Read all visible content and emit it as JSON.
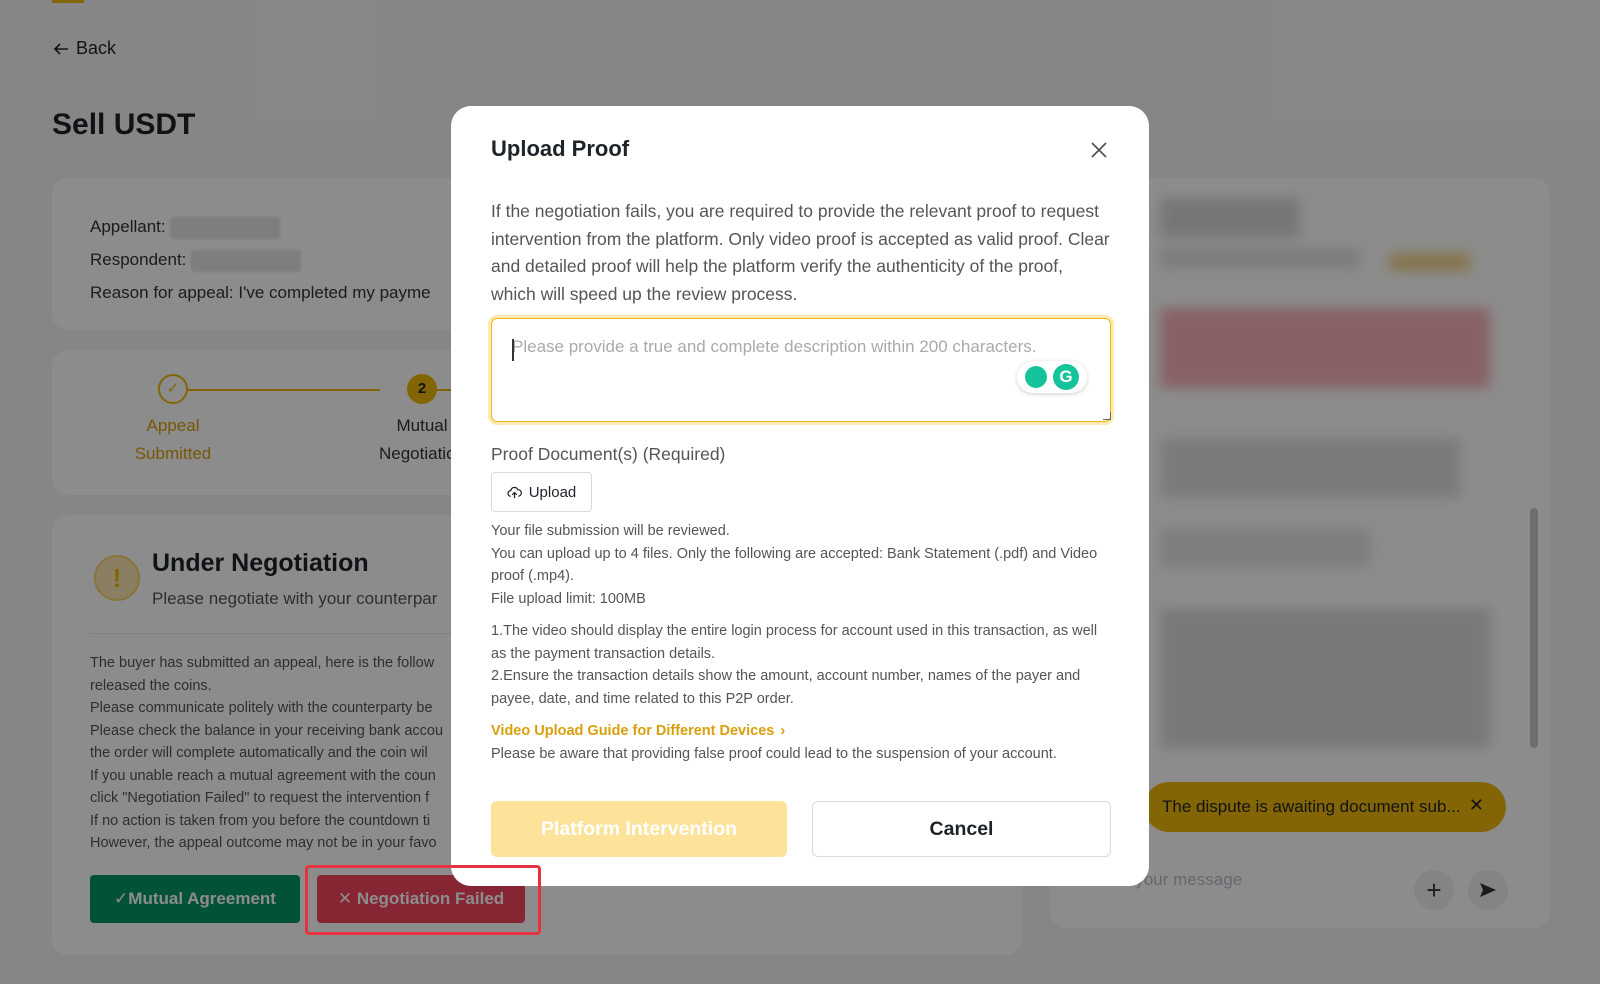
{
  "page": {
    "back_label": "Back",
    "title": "Sell USDT"
  },
  "appeal": {
    "appellant_label": "Appellant:",
    "respondent_label": "Respondent:",
    "reason_label": "Reason for appeal:",
    "reason_value": "I've completed my payme"
  },
  "steps": [
    {
      "number": "",
      "label_line1": "Appeal",
      "label_line2": "Submitted"
    },
    {
      "number": "2",
      "label_line1": "Mutual",
      "label_line2": "Negotiation"
    }
  ],
  "negotiation": {
    "title": "Under Negotiation",
    "subtitle": "Please negotiate with your counterpar",
    "body": [
      "The buyer has submitted an appeal, here is the follow",
      "released the coins.",
      "Please communicate politely with the counterparty be",
      "Please check the balance in your receiving bank accou",
      "the order will complete automatically and the coin wil",
      "If you unable reach a mutual agreement with the coun",
      "click \"Negotiation Failed\" to request the intervention f",
      "If no action is taken from you before the countdown ti",
      "However, the appeal outcome may not be in your favo"
    ],
    "agree_button": "Mutual Agreement",
    "fail_button": "Negotiation Failed"
  },
  "chat": {
    "dispute_banner": "The dispute is awaiting document sub...",
    "input_placeholder": "Enter your message"
  },
  "modal": {
    "title": "Upload Proof",
    "description": "If the negotiation fails, you are required to provide the relevant proof to request intervention from the platform. Only video proof is accepted as valid proof. Clear and detailed proof will help the platform verify the authenticity of the proof, which will speed up the review process.",
    "textarea_placeholder": "Please provide a true and complete description within 200 characters.",
    "proof_label": "Proof Document(s)  (Required)",
    "upload_button": "Upload",
    "notes": {
      "reviewed": "Your file submission will be reviewed.",
      "limit_files": "You can upload up to 4 files. Only the following are accepted: Bank Statement (.pdf) and Video proof (.mp4).",
      "size_limit": "File upload limit: 100MB",
      "rule1": "1.The video should display the entire login process for account used in this transaction, as well as the payment transaction details.",
      "rule2": "2.Ensure the transaction details show the amount, account number, names of the payer and payee, date, and time related to this P2P order."
    },
    "guide_link": "Video Upload Guide for Different Devices",
    "warning": "Please be aware that providing false proof could lead to the suspension of your account.",
    "platform_button": "Platform Intervention",
    "cancel_button": "Cancel"
  },
  "colors": {
    "accent": "#f0b90b",
    "success": "#059669",
    "danger": "#f6465d",
    "highlight_outline": "#e5343f"
  },
  "icons": {
    "back": "arrow-left-icon",
    "check": "check-icon",
    "warning": "exclamation-icon",
    "close": "close-icon",
    "upload": "cloud-upload-icon",
    "chevron": "chevron-right-icon",
    "plus": "plus-icon",
    "send": "send-icon"
  }
}
